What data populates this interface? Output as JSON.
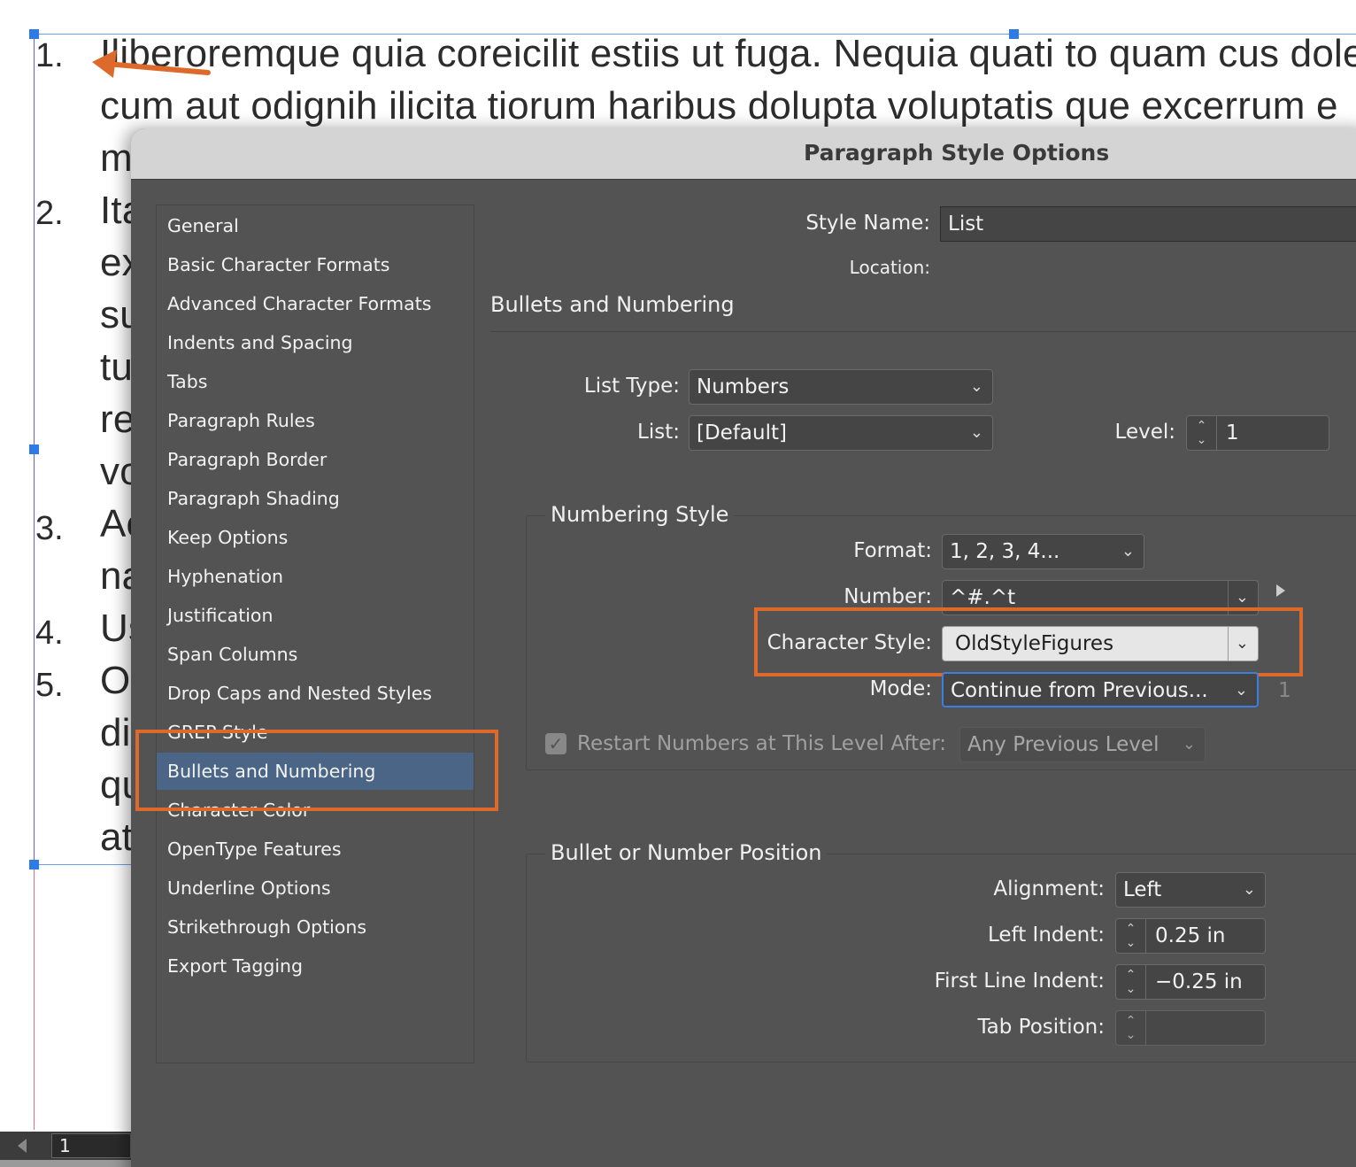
{
  "document": {
    "lines": [
      "Iliberoremque quia coreicilit estiis ut fuga. Nequia quati to quam cus dole",
      "cum aut odignih ilicita tiorum haribus dolupta voluptatis que excerrum e",
      "m",
      "Ita",
      "ex",
      "su",
      "tu",
      "re",
      "vo",
      "Ac",
      "na",
      "Us",
      "O",
      "di",
      "qu",
      "at"
    ],
    "list_numbers": [
      "1.",
      "2.",
      "3.",
      "4.",
      "5."
    ],
    "page_number": "1"
  },
  "dialog": {
    "title": "Paragraph Style Options",
    "sidebar": {
      "items": [
        "General",
        "Basic Character Formats",
        "Advanced Character Formats",
        "Indents and Spacing",
        "Tabs",
        "Paragraph Rules",
        "Paragraph Border",
        "Paragraph Shading",
        "Keep Options",
        "Hyphenation",
        "Justification",
        "Span Columns",
        "Drop Caps and Nested Styles",
        "GREP Style",
        "Bullets and Numbering",
        "Character Color",
        "OpenType Features",
        "Underline Options",
        "Strikethrough Options",
        "Export Tagging"
      ],
      "selected": "Bullets and Numbering"
    },
    "style_name_label": "Style Name:",
    "style_name_value": "List",
    "location_label": "Location:",
    "section_title": "Bullets and Numbering",
    "list_type_label": "List Type:",
    "list_type_value": "Numbers",
    "list_label": "List:",
    "list_value": "[Default]",
    "level_label": "Level:",
    "level_value": "1",
    "numbering_style": {
      "title": "Numbering Style",
      "format_label": "Format:",
      "format_value": "1, 2, 3, 4...",
      "number_label": "Number:",
      "number_value": "^#.^t",
      "char_style_label": "Character Style:",
      "char_style_value": "OldStyleFigures",
      "mode_label": "Mode:",
      "mode_value": "Continue from Previous...",
      "mode_number": "1",
      "restart_label": "Restart Numbers at This Level After:",
      "restart_value": "Any Previous Level",
      "restart_checked": true
    },
    "position": {
      "title": "Bullet or Number Position",
      "alignment_label": "Alignment:",
      "alignment_value": "Left",
      "left_indent_label": "Left Indent:",
      "left_indent_value": "0.25 in",
      "first_line_label": "First Line Indent:",
      "first_line_value": "−0.25 in",
      "tab_position_label": "Tab Position:",
      "tab_position_value": ""
    }
  },
  "colors": {
    "highlight": "#dd6a2a",
    "selection": "#4a6585",
    "dialog_bg": "#535353",
    "focus_ring": "#3d7fe0"
  },
  "icons": {
    "arrow": "orange-arrow-icon",
    "chevron": "chevron-down-icon",
    "stepper": "stepper-arrows-icon"
  }
}
